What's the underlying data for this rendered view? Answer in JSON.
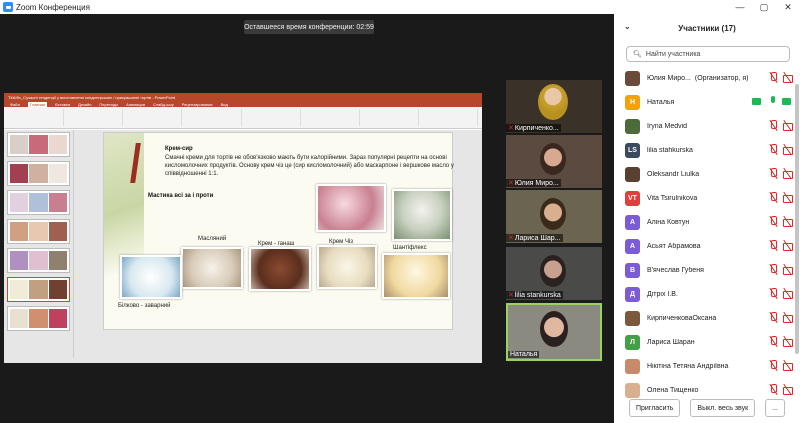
{
  "window": {
    "title": "Zoom Конференция",
    "controls": [
      "—",
      "▢",
      "✕"
    ]
  },
  "timer": "Оставшееся время конференции: 02:59",
  "powerpoint": {
    "title": "ТКАНЬ_Сучасні тенденції у виготовленні кондитерських / прикрашанні тортів - PowerPoint",
    "tabs": [
      "Файл",
      "Главная",
      "Вставка",
      "Дизайн",
      "Переходы",
      "Анимация",
      "Слайд-шоу",
      "Рецензирование",
      "Вид"
    ],
    "slide": {
      "title": "Крем-сир",
      "text": "Смачні креми для тортів не обов'язково мають бути калорійними. Зараз популярні рецепти на основі кисломолочних продуктів. Основу крем чіз це (сир кисломолочний) або маскарпоне і вершкове масло у співвідношенні 1:1.",
      "subtitle": "Мастика всі за і проти",
      "captions": [
        "Масляний",
        "Крем - ганаш",
        "Крем Чіз",
        "Шантіфлекс",
        "Білково - заварний"
      ]
    }
  },
  "videos": [
    {
      "name": "Кирпиченко..."
    },
    {
      "name": "Юлия Миро..."
    },
    {
      "name": "Лариса Шар..."
    },
    {
      "name": "lilia stankurska"
    },
    {
      "name": "Наталья"
    }
  ],
  "panel": {
    "title": "Участники (17)",
    "search_placeholder": "Найти участника",
    "participants": [
      {
        "initials": "",
        "name": "Юлия Миро...",
        "role": "(Организатор, я)",
        "color": "#6b4a3a",
        "mic": "off",
        "cam": "off"
      },
      {
        "initials": "Н",
        "name": "Наталья",
        "role": "",
        "color": "#f0a30a",
        "mic": "on",
        "cam": "on"
      },
      {
        "initials": "",
        "name": "Iryna Medvid",
        "role": "",
        "color": "#4d6b3a",
        "mic": "off",
        "cam": "off"
      },
      {
        "initials": "LS",
        "name": "lilia stahkurska",
        "role": "",
        "color": "#3b4a5e",
        "mic": "off",
        "cam": "off"
      },
      {
        "initials": "",
        "name": "Oleksandr Liulka",
        "role": "",
        "color": "#5a4030",
        "mic": "off",
        "cam": "off"
      },
      {
        "initials": "VT",
        "name": "Vita Tsirulnikova",
        "role": "",
        "color": "#d9433b",
        "mic": "off",
        "cam": "off"
      },
      {
        "initials": "А",
        "name": "Аліна Ковтун",
        "role": "",
        "color": "#7b5bd6",
        "mic": "off",
        "cam": "off"
      },
      {
        "initials": "А",
        "name": "Асьят Абрамова",
        "role": "",
        "color": "#7b5bd6",
        "mic": "off",
        "cam": "off"
      },
      {
        "initials": "В",
        "name": "В'ячеслав Губеня",
        "role": "",
        "color": "#7b5bd6",
        "mic": "off",
        "cam": "off"
      },
      {
        "initials": "Д",
        "name": "Дітріх І.В.",
        "role": "",
        "color": "#7b5bd6",
        "mic": "off",
        "cam": "off"
      },
      {
        "initials": "",
        "name": "КирпиченковаОксана",
        "role": "",
        "color": "#7a5a3a",
        "mic": "off",
        "cam": "off"
      },
      {
        "initials": "Л",
        "name": "Лариса Шаран",
        "role": "",
        "color": "#43a047",
        "mic": "off",
        "cam": "off"
      },
      {
        "initials": "",
        "name": "Нікітіна Тетяна Андріївна",
        "role": "",
        "color": "#c98a6a",
        "mic": "off",
        "cam": "off"
      },
      {
        "initials": "",
        "name": "Олена Тищенко",
        "role": "",
        "color": "#d8b090",
        "mic": "off",
        "cam": "off"
      }
    ],
    "buttons": {
      "invite": "Пригласить",
      "mute_all": "Выкл. весь звук",
      "more": "..."
    }
  }
}
